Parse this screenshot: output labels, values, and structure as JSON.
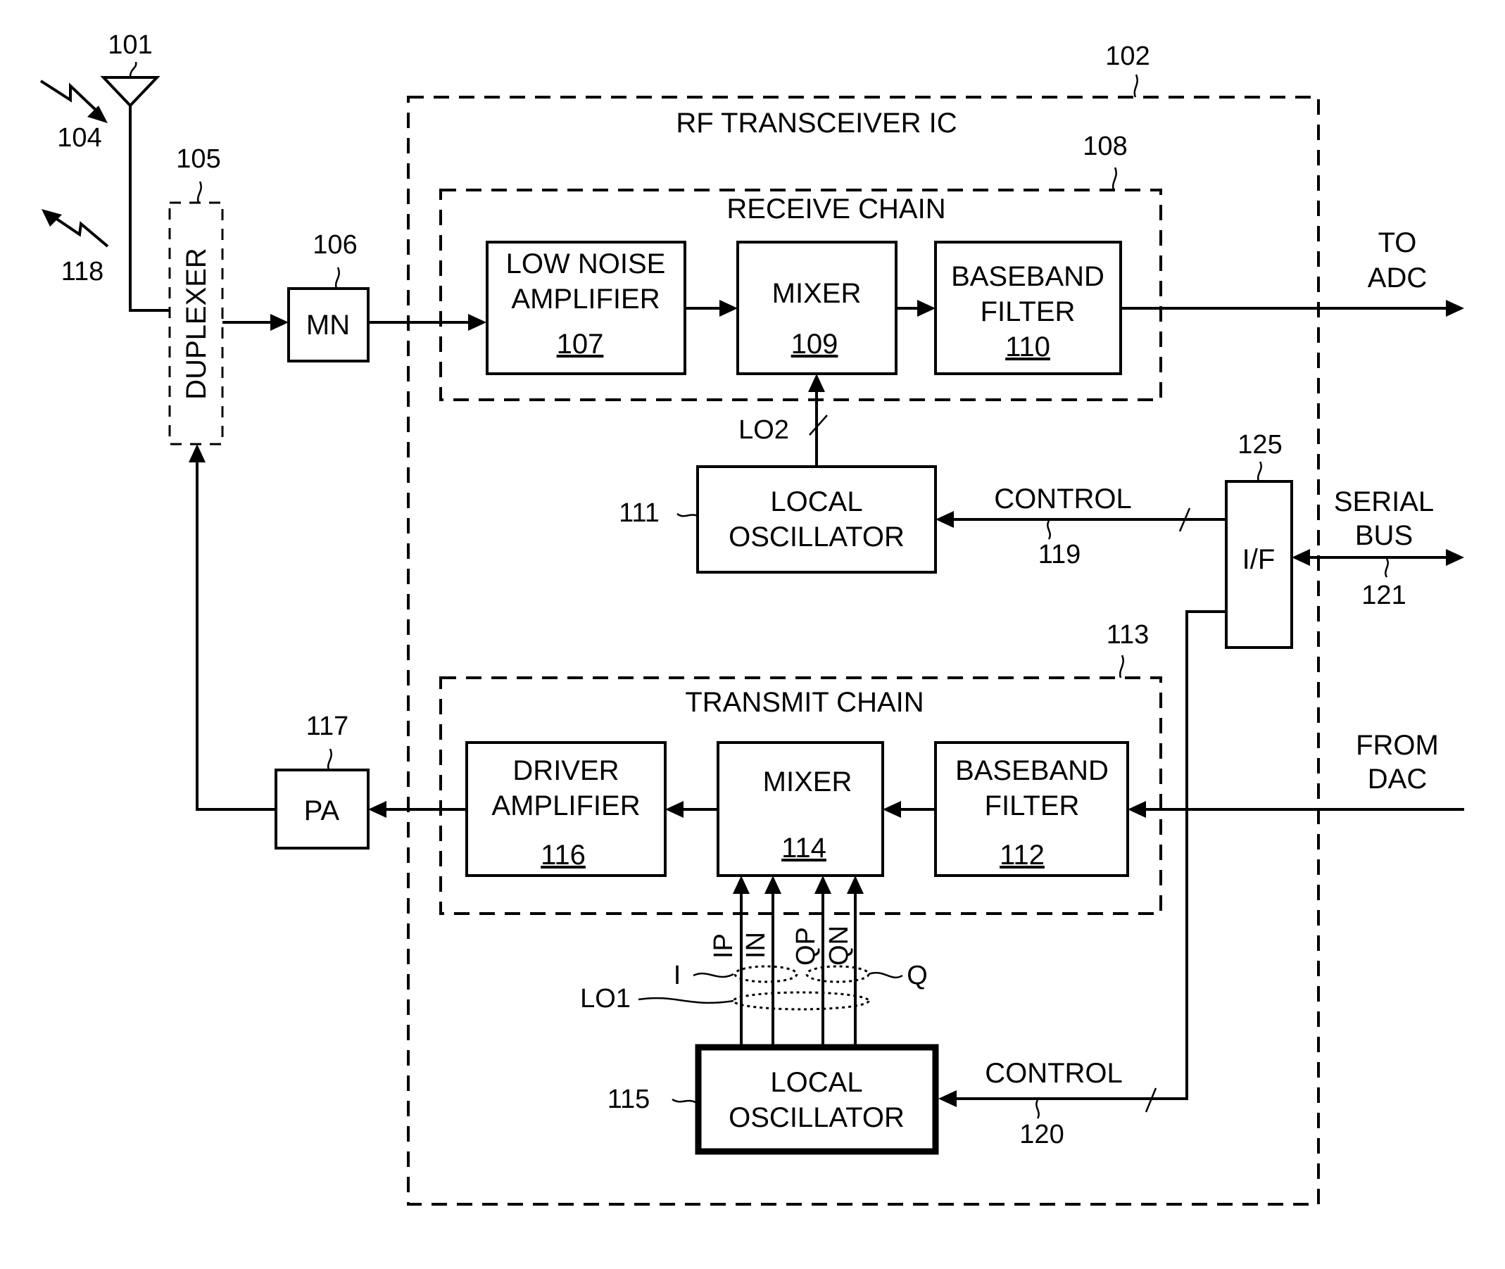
{
  "figure": {
    "ic": {
      "title": "RF TRANSCEIVER IC",
      "ref": "102"
    },
    "antenna": {
      "ref": "101"
    },
    "incoming_signal": {
      "ref": "104"
    },
    "outgoing_signal": {
      "ref": "118"
    },
    "duplexer": {
      "label": "DUPLEXER",
      "ref": "105"
    },
    "matching_network": {
      "label": "MN",
      "ref": "106"
    },
    "receive_chain": {
      "title": "RECEIVE CHAIN",
      "ref": "108",
      "lna": {
        "line1": "LOW NOISE",
        "line2": "AMPLIFIER",
        "ref": "107"
      },
      "mixer": {
        "label": "MIXER",
        "ref": "109"
      },
      "baseband_filter": {
        "line1": "BASEBAND",
        "line2": "FILTER",
        "ref": "110"
      }
    },
    "rx_local_oscillator": {
      "line1": "LOCAL",
      "line2": "OSCILLATOR",
      "ref": "111",
      "signal": "LO2"
    },
    "to_adc": {
      "line1": "TO",
      "line2": "ADC"
    },
    "control_rx": {
      "label": "CONTROL",
      "ref": "119"
    },
    "interface": {
      "label": "I/F",
      "ref": "125"
    },
    "serial_bus": {
      "line1": "SERIAL",
      "line2": "BUS",
      "ref": "121"
    },
    "transmit_chain": {
      "title": "TRANSMIT CHAIN",
      "ref": "113",
      "driver": {
        "line1": "DRIVER",
        "line2": "AMPLIFIER",
        "ref": "116"
      },
      "mixer": {
        "label": "MIXER",
        "ref": "114"
      },
      "baseband_filter": {
        "line1": "BASEBAND",
        "line2": "FILTER",
        "ref": "112"
      }
    },
    "from_dac": {
      "line1": "FROM",
      "line2": "DAC"
    },
    "power_amplifier": {
      "label": "PA",
      "ref": "117"
    },
    "tx_local_oscillator": {
      "line1": "LOCAL",
      "line2": "OSCILLATOR",
      "ref": "115",
      "signals": [
        "IP",
        "IN",
        "QP",
        "QN"
      ],
      "i_group": "I",
      "q_group": "Q",
      "lo_group": "LO1"
    },
    "control_tx": {
      "label": "CONTROL",
      "ref": "120"
    }
  }
}
